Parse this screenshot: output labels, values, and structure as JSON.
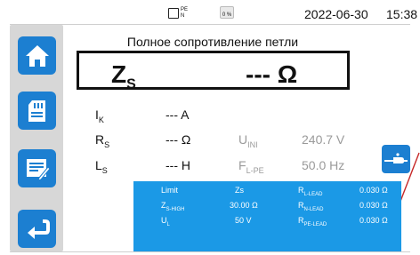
{
  "status_bar": {
    "battery_label": "PE",
    "battery_sub": "N",
    "memory_percent": "0 %",
    "date": "2022-06-30",
    "time": "15:38"
  },
  "sidebar": {
    "items": [
      {
        "icon": "home-icon"
      },
      {
        "icon": "sd-card-icon"
      },
      {
        "icon": "edit-list-icon"
      },
      {
        "icon": "back-arrow-icon"
      }
    ]
  },
  "screen": {
    "title": "Полное сопротивление петли",
    "main_symbol": "Z",
    "main_symbol_sub": "S",
    "main_value": "--- Ω"
  },
  "readings": [
    {
      "symbol": "I",
      "sub": "K",
      "value": "--- A"
    },
    {
      "symbol": "R",
      "sub": "S",
      "value": "--- Ω"
    },
    {
      "symbol": "L",
      "sub": "S",
      "value": "--- H"
    }
  ],
  "secondary": [
    {
      "symbol": "U",
      "sub": "INI",
      "value": "240.7 V"
    },
    {
      "symbol": "F",
      "sub": "L-PE",
      "value": "50.0 Hz"
    }
  ],
  "panel": {
    "row1": {
      "label": "Limit",
      "value": "Zs",
      "label2": "R",
      "label2_sub": "L-LEAD",
      "value2": "0.030 Ω"
    },
    "row2": {
      "label": "Z",
      "label_sub": "S-HIGH",
      "value": "30.00 Ω",
      "label2": "R",
      "label2_sub": "N-LEAD",
      "value2": "0.030 Ω"
    },
    "row3": {
      "label": "U",
      "label_sub": "L",
      "value": "50 V",
      "label2": "R",
      "label2_sub": "PE-LEAD",
      "value2": "0.030 Ω"
    }
  },
  "colors": {
    "accent": "#1c7fd1",
    "panel": "#1b99e6",
    "sidebar": "#d7d7d7"
  }
}
